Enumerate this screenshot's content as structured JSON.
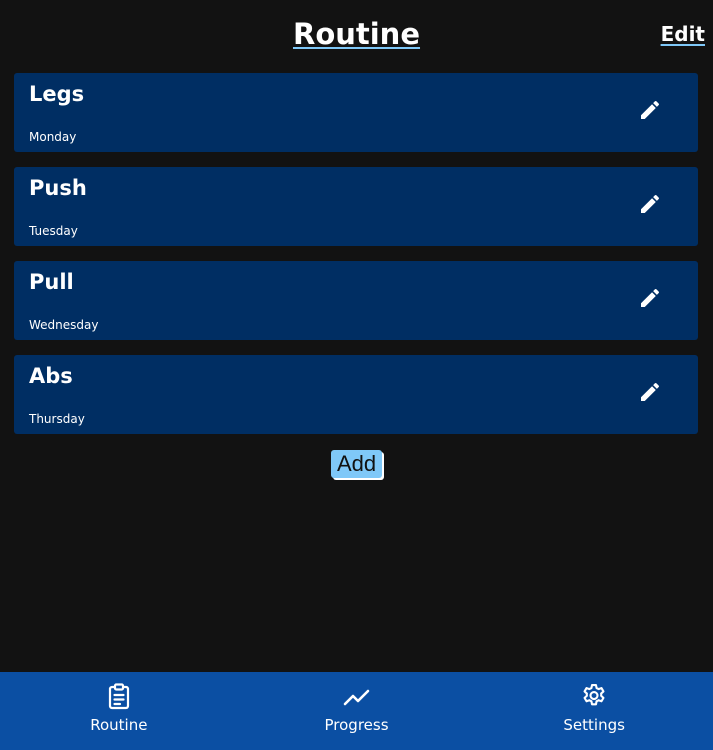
{
  "header": {
    "title": "Routine",
    "edit_label": "Edit"
  },
  "routines": [
    {
      "name": "Legs",
      "day": "Monday",
      "icon": "pencil-icon"
    },
    {
      "name": "Push",
      "day": "Tuesday",
      "icon": "pencil-icon"
    },
    {
      "name": "Pull",
      "day": "Wednesday",
      "icon": "pencil-icon"
    },
    {
      "name": "Abs",
      "day": "Thursday",
      "icon": "pencil-icon"
    }
  ],
  "add_label": "Add",
  "nav": [
    {
      "label": "Routine",
      "icon": "clipboard-list-icon"
    },
    {
      "label": "Progress",
      "icon": "trending-line-icon"
    },
    {
      "label": "Settings",
      "icon": "gear-icon"
    }
  ],
  "colors": {
    "background": "#121212",
    "card": "#002e63",
    "accent": "#7fc8f8",
    "nav": "#0b4fa3",
    "text": "#ffffff"
  }
}
